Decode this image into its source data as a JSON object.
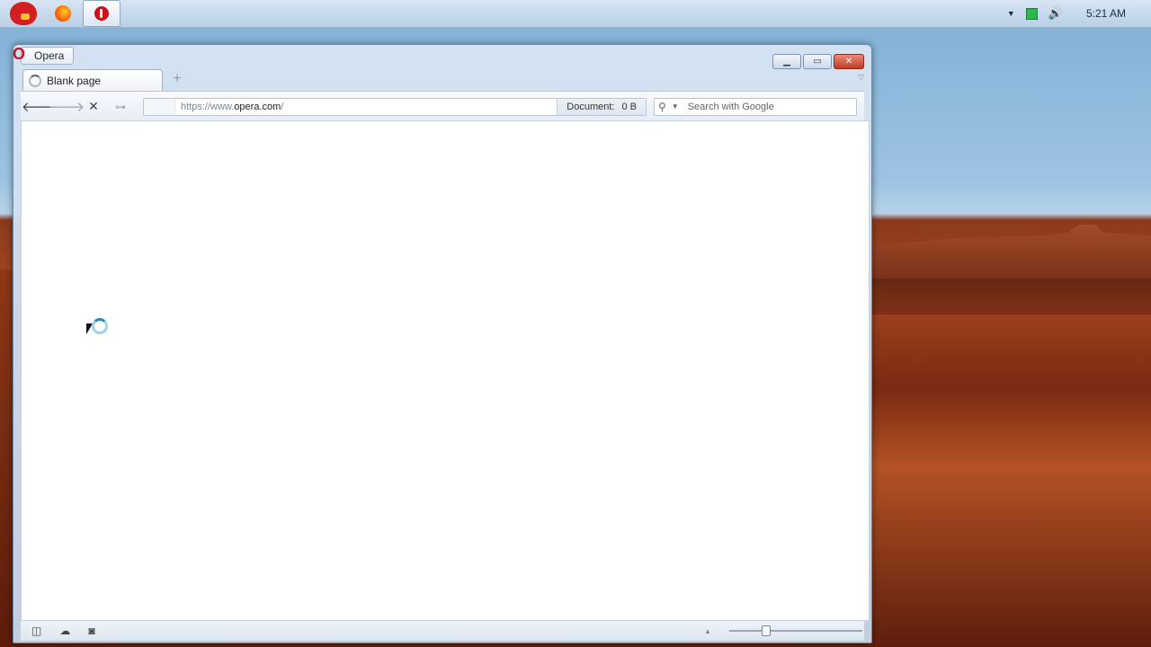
{
  "taskbar": {
    "pinned": [
      {
        "icon": "angry-bird-icon"
      },
      {
        "icon": "firefox-icon"
      },
      {
        "icon": "opera-icon",
        "active": true
      }
    ],
    "tray": {
      "clock": "5:21 AM",
      "icons": [
        "show-hidden-icons-icon",
        "battery-icon",
        "speaker-icon"
      ]
    }
  },
  "window": {
    "menu_label": "Opera",
    "controls": [
      "minimize",
      "maximize",
      "close"
    ],
    "tabs": [
      {
        "title": "Blank page",
        "loading": true
      }
    ],
    "toolbar": {
      "url_prefix": "https://www.",
      "url_host": "opera.com",
      "url_suffix": "/",
      "document_label": "Document:",
      "document_size": "0 B",
      "search_placeholder": "Search with Google"
    },
    "statusbar": {
      "zoom_fraction": 0.27
    }
  }
}
